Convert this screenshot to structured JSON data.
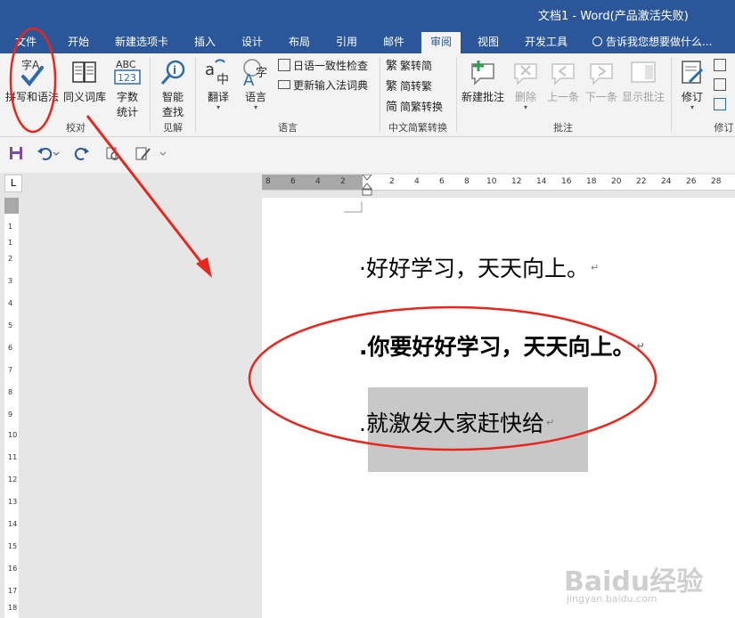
{
  "window": {
    "title": "文档1 - Word(产品激活失败)"
  },
  "tabs": [
    {
      "label": "文件"
    },
    {
      "label": "开始"
    },
    {
      "label": "新建选项卡"
    },
    {
      "label": "插入"
    },
    {
      "label": "设计"
    },
    {
      "label": "布局"
    },
    {
      "label": "引用"
    },
    {
      "label": "邮件"
    },
    {
      "label": "审阅"
    },
    {
      "label": "视图"
    },
    {
      "label": "开发工具"
    }
  ],
  "tellme": {
    "placeholder": "告诉我您想要做什么..."
  },
  "ribbon": {
    "proofing": {
      "spelling_label": "拼写和语法",
      "spelling_icon_text": "字A",
      "thesaurus_label": "同义词库",
      "wordcount_label_1": "字数",
      "wordcount_label_2": "统计",
      "wordcount_icon_top": "ABC",
      "wordcount_icon_bottom": "123",
      "group_label": "校对"
    },
    "insights": {
      "smart_lookup_1": "智能",
      "smart_lookup_2": "查找",
      "group_label": "见解"
    },
    "language": {
      "translate_label": "翻译",
      "language_label": "语言",
      "jp_consistency": "日语一致性检查",
      "update_ime": "更新输入法词典",
      "group_label": "语言"
    },
    "chinese": {
      "trad_to_simp": "繁转简",
      "simp_to_trad": "简转繁",
      "convert": "简繁转换",
      "group_label": "中文简繁转换"
    },
    "comments": {
      "new_comment": "新建批注",
      "delete": "删除",
      "previous": "上一条",
      "next": "下一条",
      "show_comments": "显示批注",
      "group_label": "批注"
    },
    "tracking": {
      "track_changes": "修订",
      "group_label": "修订"
    }
  },
  "ruler": {
    "h_ticks": [
      "8",
      "6",
      "4",
      "2",
      "2",
      "4",
      "6",
      "8",
      "10",
      "12",
      "14",
      "16",
      "18",
      "20",
      "22",
      "24",
      "26",
      "28"
    ],
    "v_ticks": [
      "1",
      "1",
      "2",
      "3",
      "4",
      "5",
      "6",
      "7",
      "8",
      "9",
      "10",
      "11",
      "12",
      "13",
      "14",
      "15",
      "16",
      "17",
      "18"
    ]
  },
  "document": {
    "paragraphs": [
      {
        "text": "好好学习，天天向上。"
      },
      {
        "text": "你要好好学习，天天向上。"
      },
      {
        "text": "就激发大家赶快给"
      }
    ]
  },
  "watermark": {
    "brand": "Baidu经验",
    "url": "jingyan.baidu.com"
  },
  "colors": {
    "title_bar": "#2b579a",
    "ribbon_bg": "#f3f3f3",
    "annotation": "#e8261c",
    "selection": "#c8c8c8"
  }
}
